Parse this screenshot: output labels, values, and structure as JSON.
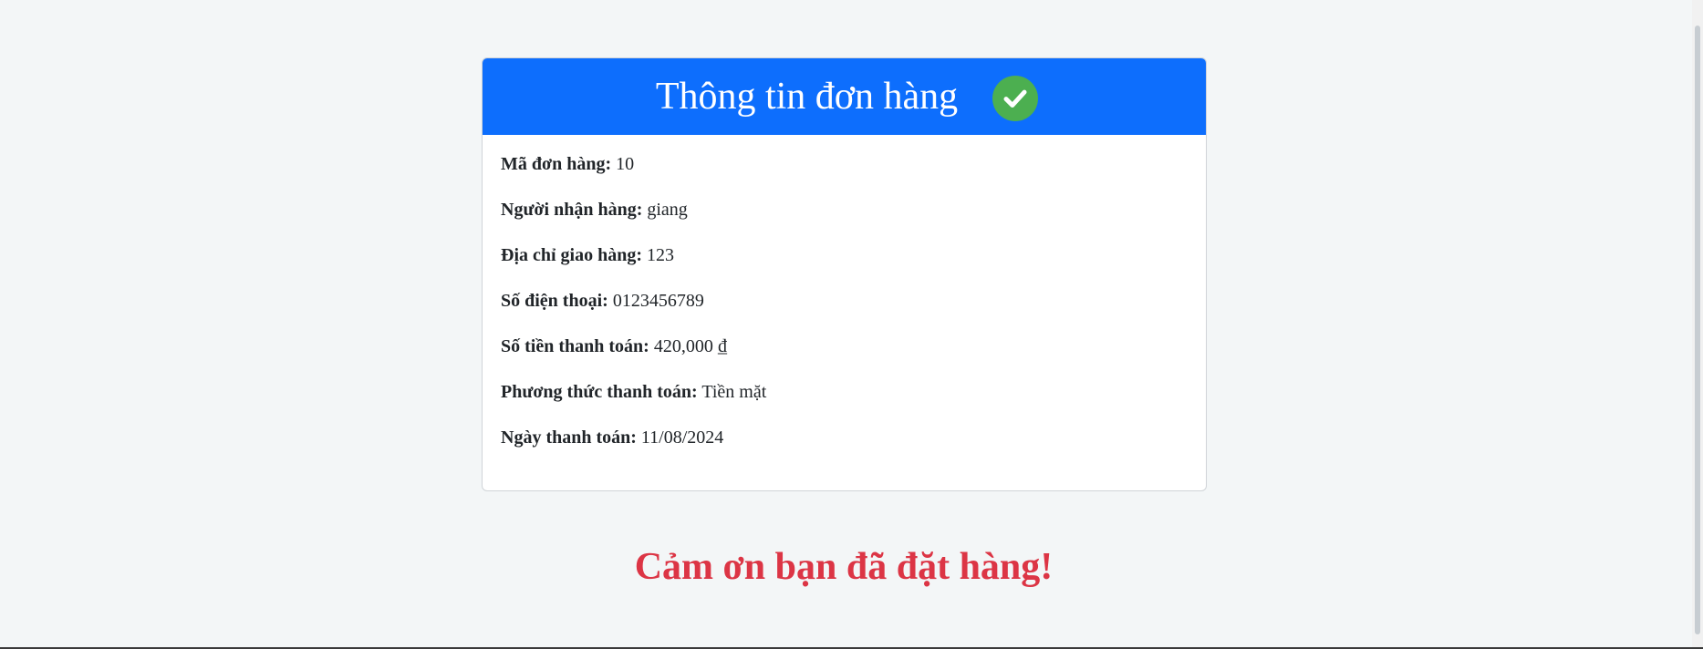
{
  "order_card": {
    "title": "Thông tin đơn hàng",
    "status_icon": "check-circle-icon",
    "fields": [
      {
        "label": "Mã đơn hàng:",
        "value": "10"
      },
      {
        "label": "Người nhận hàng:",
        "value": "giang"
      },
      {
        "label": "Địa chỉ giao hàng:",
        "value": "123"
      },
      {
        "label": "Số điện thoại:",
        "value": "0123456789"
      },
      {
        "label": "Số tiền thanh toán:",
        "value": "420,000 ₫"
      },
      {
        "label": "Phương thức thanh toán:",
        "value": "Tiền mặt"
      },
      {
        "label": "Ngày thanh toán:",
        "value": "11/08/2024"
      }
    ]
  },
  "thank_you": "Cảm ơn bạn đã đặt hàng!",
  "colors": {
    "header": "#0d6efd",
    "check": "#4caf50",
    "thank_you": "#dc3545",
    "background": "#f3f6f7"
  }
}
